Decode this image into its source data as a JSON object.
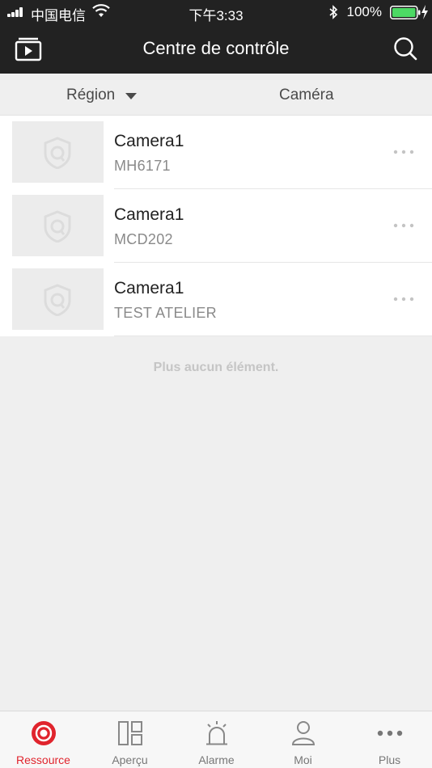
{
  "status": {
    "carrier": "中国电信",
    "time": "下午3:33",
    "battery": "100%"
  },
  "nav": {
    "title": "Centre de contrôle",
    "left_icon": "playback-icon",
    "right_icon": "search-icon"
  },
  "filters": {
    "region": "Région",
    "camera": "Caméra"
  },
  "devices": [
    {
      "name": "Camera1",
      "model": "MH6171"
    },
    {
      "name": "Camera1",
      "model": "MCD202"
    },
    {
      "name": "Camera1",
      "model": "TEST ATELIER"
    }
  ],
  "empty_message": "Plus aucun élément.",
  "tabs": [
    {
      "label": "Ressource",
      "icon": "ressource-icon",
      "active": true
    },
    {
      "label": "Aperçu",
      "icon": "apercu-icon",
      "active": false
    },
    {
      "label": "Alarme",
      "icon": "alarm-icon",
      "active": false
    },
    {
      "label": "Moi",
      "icon": "user-icon",
      "active": false
    },
    {
      "label": "Plus",
      "icon": "more-icon",
      "active": false
    }
  ],
  "colors": {
    "header_bg": "#222222",
    "accent": "#e0242d",
    "battery": "#4cd964"
  }
}
